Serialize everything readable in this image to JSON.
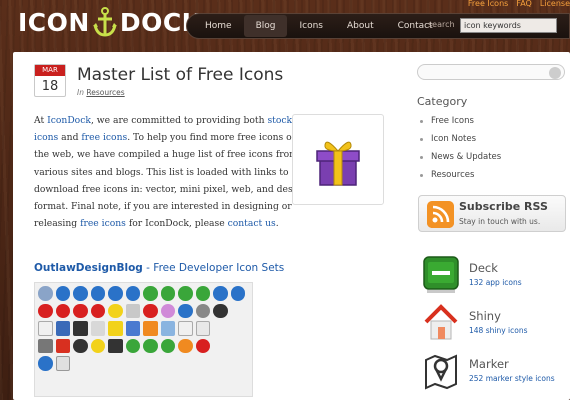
{
  "header": {
    "logo_left": "ICON",
    "logo_right": "DOCK",
    "top_links": [
      "Free Icons",
      "FAQ",
      "License"
    ],
    "nav": [
      "Home",
      "Blog",
      "Icons",
      "About",
      "Contact"
    ],
    "active_nav": "Blog",
    "search_label": "search",
    "search_value": "icon keywords"
  },
  "post": {
    "date_month": "MAR",
    "date_day": "18",
    "title": "Master List of Free Icons",
    "meta_prefix": "In",
    "meta_category": "Resources",
    "body": {
      "p1": "At ",
      "link_icondock": "IconDock",
      "p2": ", we are committed to providing both ",
      "link_stock": "stock icons",
      "p3": " and ",
      "link_free1": "free icons",
      "p4": ". To help you find more free icons on the web, we have compiled a huge list of free icons from various sites and blogs. This list is loaded with links to download free icons in: vector, mini pixel, web, and desktop format. Final note, if you are interested in designing or releasing ",
      "link_free2": "free icons",
      "p5": " for IconDock, please ",
      "link_contact": "contact us",
      "p6": "."
    },
    "sub_site": "OutlawDesignBlog",
    "sub_sep": " - ",
    "sub_desc": "Free Developer Icon Sets"
  },
  "sidebar": {
    "category_title": "Category",
    "categories": [
      "Free Icons",
      "Icon Notes",
      "News & Updates",
      "Resources"
    ],
    "rss_title": "Subscribe RSS",
    "rss_sub": "Stay in touch with us.",
    "sets": [
      {
        "name": "Deck",
        "count": "132 app icons"
      },
      {
        "name": "Shiny",
        "count": "148 shiny icons"
      },
      {
        "name": "Marker",
        "count": "252 marker style icons"
      }
    ]
  },
  "colors": {
    "accent_orange": "#f7a13c",
    "link_blue": "#1e5aa8",
    "date_red": "#c9201e",
    "background_brown": "#4a2616"
  }
}
